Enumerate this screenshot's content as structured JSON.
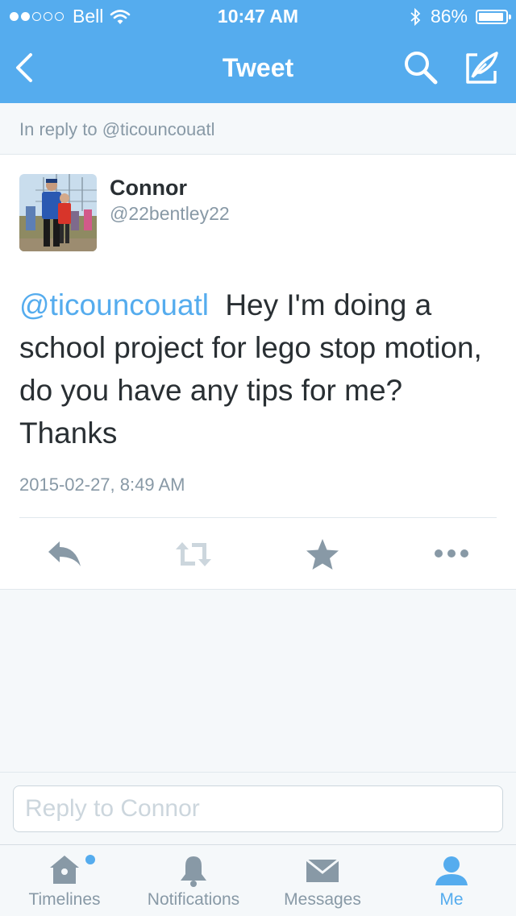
{
  "status_bar": {
    "carrier": "Bell",
    "time": "10:47 AM",
    "battery": "86%"
  },
  "nav": {
    "title": "Tweet",
    "icons": [
      "back-chevron-icon",
      "search-icon",
      "compose-icon"
    ]
  },
  "reply_context": "In reply to @ticouncouatl",
  "tweet": {
    "name": "Connor",
    "handle": "@22bentley22",
    "mention": "@ticouncouatl",
    "text": "Hey I'm doing a school project for lego stop motion, do you have any tips for me? Thanks",
    "timestamp": "2015-02-27, 8:49 AM",
    "actions": [
      "reply-icon",
      "retweet-icon",
      "favorite-icon",
      "more-icon"
    ]
  },
  "reply_box": {
    "placeholder": "Reply to Connor"
  },
  "tabs": [
    {
      "label": "Timelines",
      "icon": "home-icon",
      "active": false,
      "has_new": true
    },
    {
      "label": "Notifications",
      "icon": "bell-icon",
      "active": false
    },
    {
      "label": "Messages",
      "icon": "envelope-icon",
      "active": false
    },
    {
      "label": "Me",
      "icon": "person-icon",
      "active": true
    }
  ],
  "colors": {
    "brand": "#55ACEE",
    "text": "#292F33",
    "muted": "#8899A6",
    "background": "#F5F8FA"
  }
}
